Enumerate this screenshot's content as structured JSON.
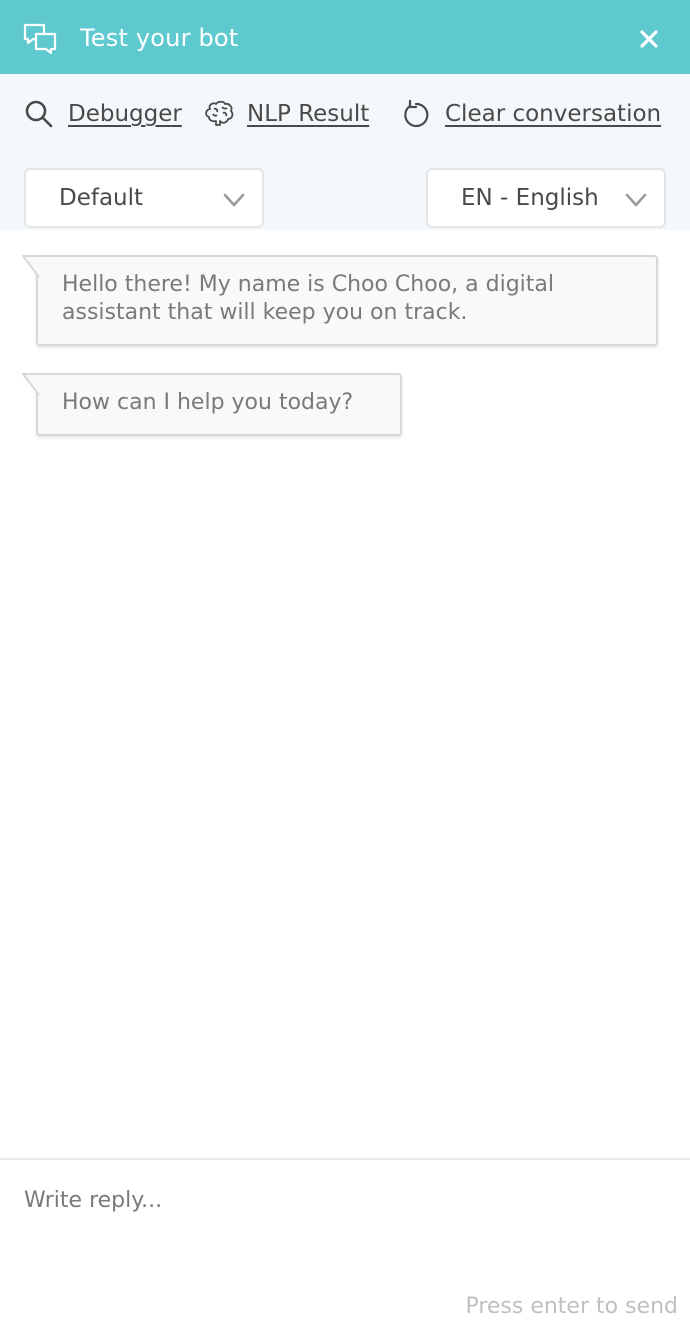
{
  "header": {
    "title": "Test your bot",
    "icon": "chat-bubbles-icon",
    "close_icon": "close-icon",
    "background": "#5ecad0"
  },
  "toolbar": {
    "debugger_label": "Debugger",
    "nlp_label": "NLP Result",
    "clear_label": "Clear conversation",
    "environment_select": "Default",
    "language_select": "EN - English"
  },
  "messages": [
    {
      "from": "bot",
      "text": "Hello there! My name is Choo Choo, a digital assistant that will keep you on track."
    },
    {
      "from": "bot",
      "text": "How can I help you today?"
    }
  ],
  "reply": {
    "placeholder": "Write reply...",
    "hint": "Press enter to send"
  }
}
